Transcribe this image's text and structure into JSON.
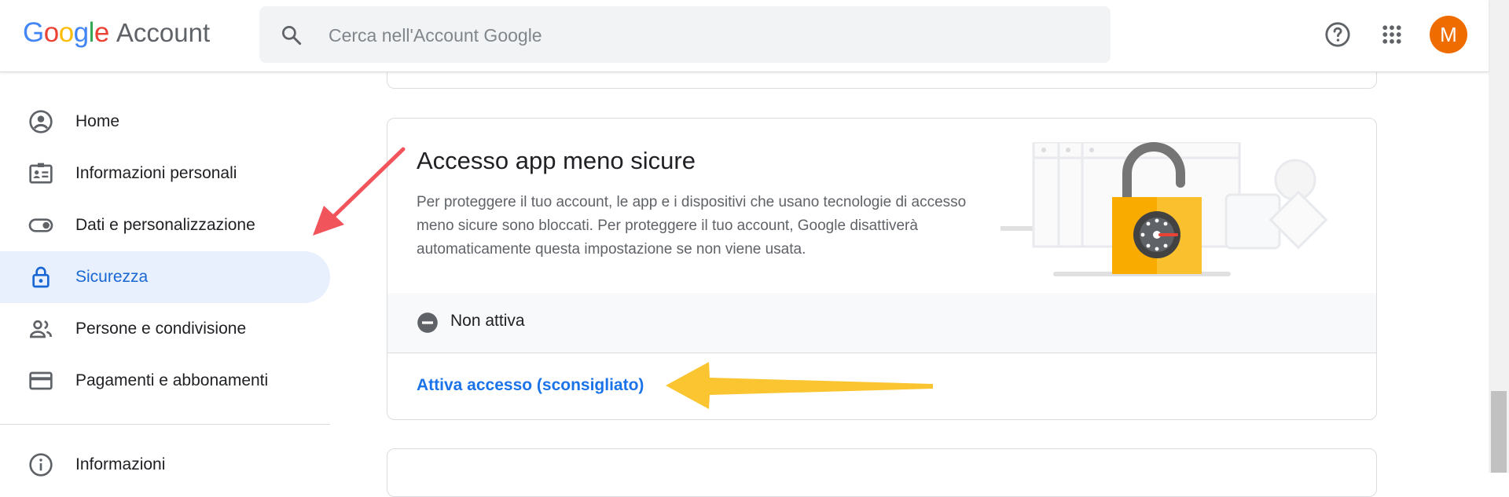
{
  "header": {
    "logo_text": "Google",
    "logo_suffix": "Account",
    "search_placeholder": "Cerca nell'Account Google",
    "avatar_letter": "M",
    "brand_colors": {
      "blue": "#4285f4",
      "red": "#ea4335",
      "yellow": "#fbbc05",
      "green": "#34a853"
    }
  },
  "sidebar": {
    "items": [
      {
        "label": "Home",
        "icon": "account-circle-icon"
      },
      {
        "label": "Informazioni personali",
        "icon": "id-card-icon"
      },
      {
        "label": "Dati e personalizzazione",
        "icon": "toggle-icon"
      },
      {
        "label": "Sicurezza",
        "icon": "lock-icon",
        "active": true
      },
      {
        "label": "Persone e condivisione",
        "icon": "people-icon"
      },
      {
        "label": "Pagamenti e abbonamenti",
        "icon": "credit-card-icon"
      }
    ],
    "footer_items": [
      {
        "label": "Informazioni",
        "icon": "info-icon"
      }
    ]
  },
  "card": {
    "title": "Accesso app meno sicure",
    "description": "Per proteggere il tuo account, le app e i dispositivi che usano tecnologie di accesso meno sicure sono bloccati. Per proteggere il tuo account, Google disattiverà automaticamente questa impostazione se non viene usata.",
    "status": "Non attiva",
    "action_link": "Attiva accesso (sconsigliato)"
  },
  "colors": {
    "accent": "#1a73e8",
    "active_nav_bg": "#e8f0fe",
    "avatar_bg": "#ef6c00",
    "annotation_red": "#f2545b",
    "annotation_yellow": "#fbc531"
  }
}
